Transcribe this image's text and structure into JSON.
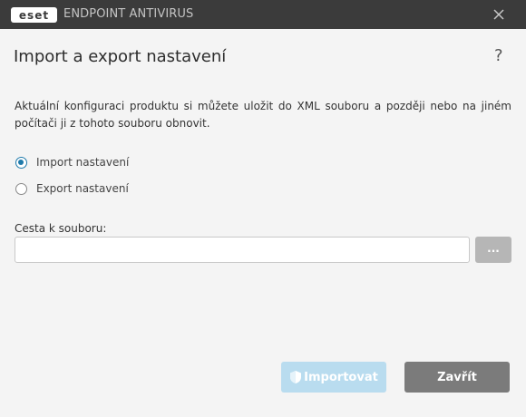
{
  "titlebar": {
    "logo_text": "eset",
    "app_title": "ENDPOINT ANTIVIRUS",
    "close_icon": "close-icon"
  },
  "dialog": {
    "title": "Import a export nastavení",
    "help_label": "?",
    "description": "Aktuální konfiguraci produktu si můžete uložit do XML souboru a později nebo na jiném počítači ji z tohoto souboru obnovit.",
    "options": [
      {
        "label": "Import nastavení",
        "selected": true
      },
      {
        "label": "Export nastavení",
        "selected": false
      }
    ],
    "path_label": "Cesta k souboru:",
    "path_value": "",
    "browse_label": "...",
    "import_label": "Importovat",
    "import_icon": "shield-icon",
    "close_label": "Zavřít"
  },
  "colors": {
    "titlebar_bg": "#3b3b3b",
    "accent": "#1f7aab",
    "import_btn_disabled": "#b9dcef",
    "close_btn": "#7b7b7b"
  }
}
